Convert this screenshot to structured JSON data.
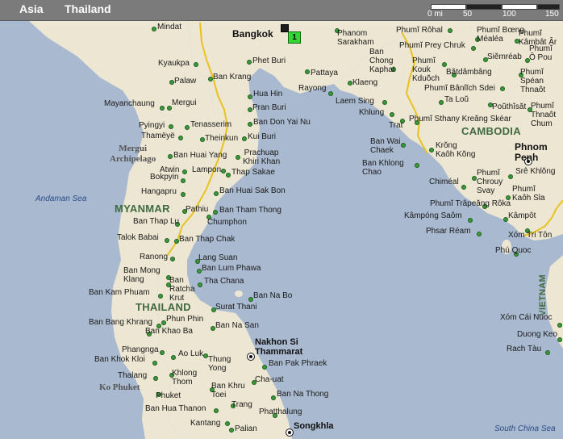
{
  "breadcrumb": {
    "region": "Asia",
    "country": "Thailand"
  },
  "scale": {
    "labels": [
      "0 mi",
      "50",
      "100",
      "150"
    ]
  },
  "badge": {
    "label": "1"
  },
  "colors": {
    "sea": "#a9b9cf",
    "land": "#ece6d2",
    "border": "#e8c21e",
    "dot": "#3a9a3a",
    "badge": "#33d633"
  },
  "countries": {
    "myanmar": "MYANMAR",
    "thailand": "THAILAND",
    "cambodia": "CAMBODIA",
    "vietnam": "VIETNAM"
  },
  "seas": {
    "andaman": "Andaman Sea",
    "south_china": "South China Sea"
  },
  "regions": {
    "mergui": "Mergui\nArchipelago",
    "phuket": "Ko Phuket"
  },
  "cities": {
    "bangkok": "Bangkok",
    "phnom_penh": "Phnom\nPenh",
    "nakhon": "Nakhon Si\nThammarat",
    "songkhla": "Songkhla",
    "mindat": "Mindat",
    "phetburi": "Phet Buri",
    "kyaukpa": "Kyaukpa",
    "palaw": "Palaw",
    "bankrang": "Ban Krang",
    "huahin": "Hua Hin",
    "pranburi": "Pran Buri",
    "mayanchaung": "Mayanchaung",
    "mergui": "Mergui",
    "tenasserim": "Tenasserim",
    "bandonyainu": "Ban Don Yai Nu",
    "pyingyi": "Pyingyi",
    "thameye": "Thamëyë",
    "theinkun": "Theinkun",
    "kuiburi": "Kui Buri",
    "banhuaiyang": "Ban Huai Yang",
    "prachuap": "Prachuap\nKhiri Khan",
    "atwin": "Atwin",
    "bokpyin": "Bokpyin",
    "lampon": "Lampon",
    "thapsakae": "Thap Sakae",
    "hangapru": "Hangapru",
    "banhuaisakbon": "Ban Huai Sak Bon",
    "pathiu": "Pathiu",
    "banthamthong": "Ban Tham Thong",
    "banthaplu": "Ban Thap Lu",
    "chumphon": "Chumphon",
    "talokbabai": "Talok Babai",
    "banthapchak": "Ban Thap Chak",
    "ranong": "Ranong",
    "langsuan": "Lang Suan",
    "banlumphawa": "Ban Lum Phawa",
    "banmongklang": "Ban Mong\nKlang",
    "banratchakrut": "Ban\nRatcha\nKrut",
    "thachana": "Tha Chana",
    "bankamphuam": "Ban Kam Phuam",
    "bannabo": "Ban Na Bo",
    "suratthani": "Surat Thani",
    "phunphin": "Phun Phin",
    "banbangkhrang": "Ban Bang Khrang",
    "bankhaoba": "Ban Khao Ba",
    "bannasan": "Ban Na San",
    "phangnga": "Phangnga",
    "aoluk": "Ao Luk",
    "thungyong": "Thung\nYong",
    "bankhokkloi": "Ban Khok Kloi",
    "banpakphraek": "Ban Pak Phraek",
    "khlongthom": "Khlong\nThom",
    "thalang": "Thalang",
    "chauat": "Cha-uat",
    "phuket": "Phuket",
    "bankhrutoei": "Ban Khru\nToei",
    "bannathong": "Ban Na Thong",
    "trang": "Trang",
    "banhuathanon": "Ban Hua Thanon",
    "phatthalung": "Phatthalung",
    "kantang": "Kantang",
    "palian": "Palian",
    "phanom": "Phanom\nSarakham",
    "pattaya": "Pattaya",
    "rayong": "Rayong",
    "banchong": "Ban\nChong\nKaphat",
    "klaeng": "Klaeng",
    "laemsing": "Laem Sing",
    "khlung": "Khlung",
    "trat": "Trat",
    "banwaichaek": "Ban Wai\nChaek",
    "bankhlongchao": "Ban Khlong\nChao",
    "phumirohal": "Phumĭ Rôhal",
    "phumiboeng": "Phumĭ Bœng\nMéaléa",
    "phumikambot": "Phumĭ\nKâmbât Âr",
    "phumipreychruk": "Phumĭ Prey Chruk",
    "siemreab": "Siĕmréab",
    "phumiopou": "Phumĭ\nÔ Pou",
    "phumikoukkduoch": "Phumĭ\nKouk\nKduŏch",
    "batdambang": "Bătdâmbâng",
    "phumispean": "Phumĭ\nSpéan\nThnaôt",
    "phumibanlichsdei": "Phumĭ Bânlĭch Sdei",
    "talou": "Ta Loŭ",
    "pouthisat": "Poŭthĭsăt",
    "phumithnaot": "Phumĭ\nThnaôt\nChum",
    "phumisthanykraeng": "Phumĭ Sthany Kreăng Skéar",
    "kronkaohkong": "Krŏng\nKaôh Kŏng",
    "chimeal": "Chiméal",
    "phumichrouy": "Phumĭ\nChrouy\nSvay",
    "srekhlong": "Srê Khlŏng",
    "phumikaohsla": "Phumĭ\nKaôh Sla",
    "phumitrapeang": "Phumĭ Trâpeăng Rôka",
    "kampongsaom": "Kâmpóng Saôm",
    "kampot": "Kâmpôt",
    "phsarream": "Phsar Réam",
    "xomtriton": "Xóm Tri Tôn",
    "phuquoc": "Phú Quoc",
    "xomcainuoc": "Xóm Cái Nuoc",
    "duongkeo": "Duong Keo",
    "rachtau": "Rach Tàu"
  }
}
